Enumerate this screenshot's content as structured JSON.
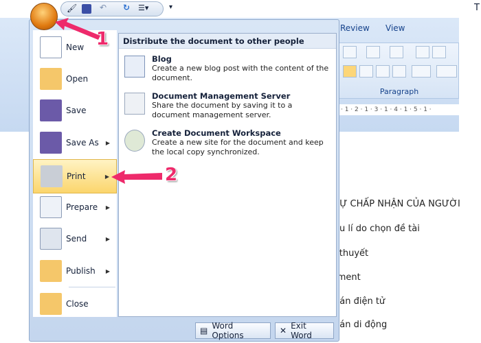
{
  "window": {
    "title_fragment": "T"
  },
  "ribbon": {
    "tabs": [
      "Review",
      "View"
    ],
    "group_label": "Paragraph",
    "ruler": "· 1 · 2 · 1 · 3 · 1 · 4 · 1 · 5 · 1 ·"
  },
  "document": {
    "lines": [
      "SỰ CHẤP NHẬN CỦA NGƯỜI",
      "ệu lí do chọn đề tài",
      "í thuyết",
      "-ment",
      "bán điện tử",
      "bán di động"
    ]
  },
  "office_menu": {
    "items": [
      {
        "label": "New",
        "icon": "new-document-icon",
        "submenu": false
      },
      {
        "label": "Open",
        "icon": "open-folder-icon",
        "submenu": false
      },
      {
        "label": "Save",
        "icon": "save-disk-icon",
        "submenu": false
      },
      {
        "label": "Save As",
        "icon": "save-as-icon",
        "submenu": true
      },
      {
        "label": "Print",
        "icon": "printer-icon",
        "submenu": true,
        "selected": true
      },
      {
        "label": "Prepare",
        "icon": "prepare-icon",
        "submenu": true
      },
      {
        "label": "Send",
        "icon": "send-icon",
        "submenu": true
      },
      {
        "label": "Publish",
        "icon": "publish-icon",
        "submenu": true
      },
      {
        "label": "Close",
        "icon": "close-folder-icon",
        "submenu": false
      }
    ],
    "panel": {
      "header": "Distribute the document to other people",
      "entries": [
        {
          "title": "Blog",
          "desc": "Create a new blog post with the content of the document.",
          "icon": "blog-icon"
        },
        {
          "title": "Document Management Server",
          "desc": "Share the document by saving it to a document management server.",
          "icon": "document-server-icon"
        },
        {
          "title": "Create Document Workspace",
          "desc": "Create a new site for the document and keep the local copy synchronized.",
          "icon": "workspace-icon"
        }
      ]
    },
    "word_options": "Word Options",
    "exit_word": "Exit Word"
  },
  "annotations": {
    "step1": "1",
    "step2": "2",
    "color": "#ee2a6b"
  }
}
